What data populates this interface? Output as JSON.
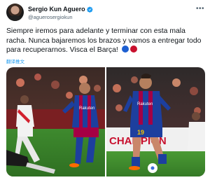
{
  "author": {
    "name": "Sergio Kun Aguero",
    "handle": "@aguerosergiokun",
    "verified": true
  },
  "tweet": {
    "text": "Siempre iremos para adelante y terminar con esta mala racha. Nunca bajaremos los brazos y vamos a entregar todo para recuperarnos. Visca el Barça!",
    "translate_label": "翻译推文"
  },
  "media": {
    "images": [
      {
        "shirt_text": "Rakuten"
      },
      {
        "shirt_text": "Rakuten",
        "number": "19",
        "board_text": "CHAMPION"
      }
    ]
  },
  "icons": {
    "more": "more-options-icon",
    "verified": "verified-badge-icon",
    "flags": [
      "blue-circle",
      "red-circle"
    ]
  },
  "colors": {
    "link": "#1d9bf0",
    "secondary_text": "#536471",
    "barca_blue": "#1d5fd1",
    "barca_red": "#a50044"
  }
}
